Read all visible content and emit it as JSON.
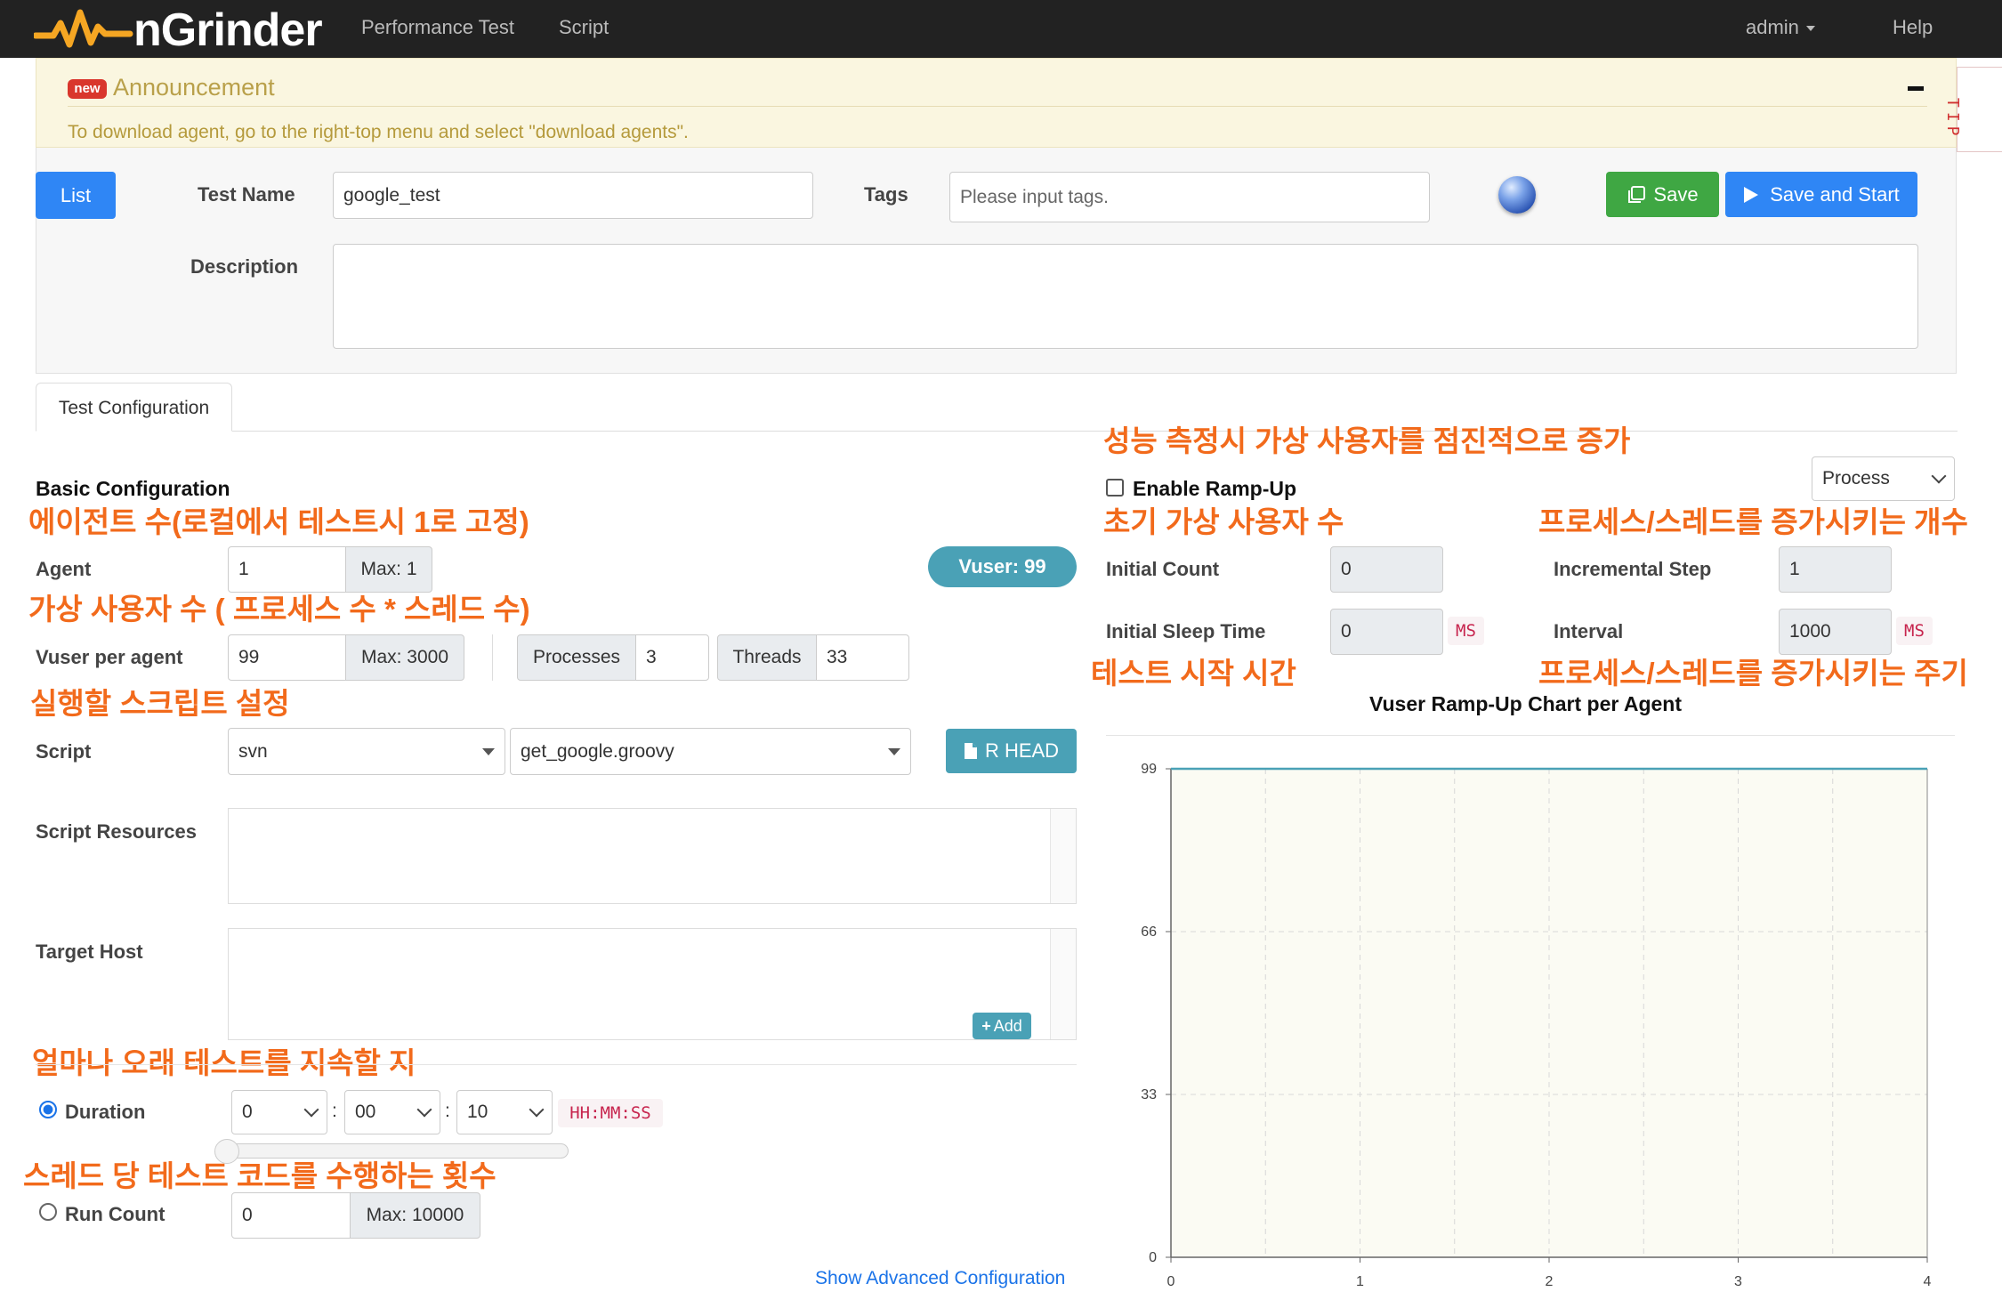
{
  "navbar": {
    "brand": "nGrinder",
    "links": [
      "Performance Test",
      "Script"
    ],
    "user": "admin",
    "help": "Help",
    "accent_color": "#f5a623"
  },
  "announcement": {
    "badge": "new",
    "title": "Announcement",
    "message": "To download agent, go to the right-top menu and select \"download agents\".",
    "tip": "TIP"
  },
  "header": {
    "list_button": "List",
    "test_name_label": "Test Name",
    "test_name_value": "google_test",
    "tags_label": "Tags",
    "tags_placeholder": "Please input tags.",
    "description_label": "Description",
    "description_value": "",
    "save_button": "Save",
    "save_start_button": "Save and Start"
  },
  "tabs": [
    "Test Configuration"
  ],
  "annotations": {
    "rampup": "성능 측정시 가상 사용자를 점진적으로 증가",
    "agent": "에이전트 수(로컬에서 테스트시 1로 고정)",
    "initial_count": "초기 가상 사용자 수",
    "incremental_step": "프로세스/스레드를 증가시키는 개수",
    "vuser": "가상 사용자 수 ( 프로세스 수 * 스레드 수)",
    "initial_sleep": "테스트 시작 시간",
    "interval": "프로세스/스레드를 증가시키는 주기",
    "script": "실행할 스크립트 설정",
    "duration": "얼마나 오래 테스트를 지속할 지",
    "run_count": "스레드 당 테스트 코드를 수행하는 횟수"
  },
  "basic": {
    "title": "Basic Configuration",
    "agent_label": "Agent",
    "agent_value": "1",
    "agent_max": "Max: 1",
    "vuser_badge": "Vuser: 99",
    "vuser_label": "Vuser per agent",
    "vuser_value": "99",
    "vuser_max": "Max: 3000",
    "processes_label": "Processes",
    "processes_value": "3",
    "threads_label": "Threads",
    "threads_value": "33",
    "script_label": "Script",
    "script_repo": "svn",
    "script_file": "get_google.groovy",
    "rhead_button": "R HEAD",
    "resources_label": "Script Resources",
    "target_host_label": "Target Host",
    "add_button": "Add",
    "duration_label": "Duration",
    "duration_hours": "0",
    "duration_minutes": "00",
    "duration_seconds": "10",
    "duration_format": "HH:MM:SS",
    "duration_selected": true,
    "run_count_label": "Run Count",
    "run_count_value": "0",
    "run_count_max": "Max: 10000",
    "advanced_link": "Show Advanced Configuration",
    "slider_level": 0
  },
  "rampup": {
    "enable_label": "Enable Ramp-Up",
    "enabled": false,
    "mode": "Process",
    "initial_count_label": "Initial Count",
    "initial_count_value": "0",
    "incremental_step_label": "Incremental Step",
    "incremental_step_value": "1",
    "initial_sleep_label": "Initial Sleep Time",
    "initial_sleep_value": "0",
    "initial_sleep_unit": "MS",
    "interval_label": "Interval",
    "interval_value": "1000",
    "interval_unit": "MS"
  },
  "chart_data": {
    "type": "line",
    "title": "Vuser Ramp-Up Chart per Agent",
    "x": [
      0,
      4
    ],
    "series": [
      {
        "values": [
          99,
          99
        ]
      }
    ],
    "x_ticks": [
      "0",
      "1",
      "2",
      "3",
      "4"
    ],
    "y_ticks": [
      "0",
      "33",
      "66",
      "99"
    ],
    "xlim": [
      0,
      4
    ],
    "ylim": [
      0,
      99
    ],
    "grid": true,
    "line_color": "#4aa1b6",
    "plot_background": "#fbfbf3"
  }
}
